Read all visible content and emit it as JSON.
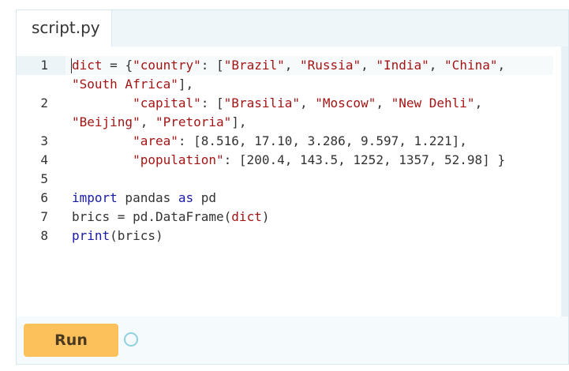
{
  "tab": {
    "label": "script.py"
  },
  "run_button": {
    "label": "Run"
  },
  "editor": {
    "line_numbers": [
      "1",
      "2",
      "3",
      "4",
      "5",
      "6",
      "7",
      "8"
    ],
    "lines": [
      {
        "tokens": [
          {
            "t": "dict",
            "c": "str"
          },
          {
            "t": " = ",
            "c": "op"
          },
          {
            "t": "{",
            "c": "op"
          },
          {
            "t": "\"country\"",
            "c": "str"
          },
          {
            "t": ": [",
            "c": "op"
          },
          {
            "t": "\"Brazil\"",
            "c": "str"
          },
          {
            "t": ", ",
            "c": "op"
          },
          {
            "t": "\"Russia\"",
            "c": "str"
          },
          {
            "t": ", ",
            "c": "op"
          },
          {
            "t": "\"India\"",
            "c": "str"
          },
          {
            "t": ", ",
            "c": "op"
          },
          {
            "t": "\"China\"",
            "c": "str"
          },
          {
            "t": ",",
            "c": "op"
          }
        ]
      },
      {
        "tokens": [
          {
            "t": "\"South Africa\"",
            "c": "str"
          },
          {
            "t": "],",
            "c": "op"
          }
        ]
      },
      {
        "tokens": [
          {
            "t": "        ",
            "c": "op"
          },
          {
            "t": "\"capital\"",
            "c": "str"
          },
          {
            "t": ": [",
            "c": "op"
          },
          {
            "t": "\"Brasilia\"",
            "c": "str"
          },
          {
            "t": ", ",
            "c": "op"
          },
          {
            "t": "\"Moscow\"",
            "c": "str"
          },
          {
            "t": ", ",
            "c": "op"
          },
          {
            "t": "\"New Dehli\"",
            "c": "str"
          },
          {
            "t": ",",
            "c": "op"
          }
        ]
      },
      {
        "tokens": [
          {
            "t": "\"Beijing\"",
            "c": "str"
          },
          {
            "t": ", ",
            "c": "op"
          },
          {
            "t": "\"Pretoria\"",
            "c": "str"
          },
          {
            "t": "],",
            "c": "op"
          }
        ]
      },
      {
        "tokens": [
          {
            "t": "        ",
            "c": "op"
          },
          {
            "t": "\"area\"",
            "c": "str"
          },
          {
            "t": ": [8.516, 17.10, 3.286, 9.597, 1.221],",
            "c": "op"
          }
        ]
      },
      {
        "tokens": [
          {
            "t": "        ",
            "c": "op"
          },
          {
            "t": "\"population\"",
            "c": "str"
          },
          {
            "t": ": [200.4, 143.5, 1252, 1357, 52.98] }",
            "c": "op"
          }
        ]
      },
      {
        "tokens": []
      },
      {
        "tokens": [
          {
            "t": "import",
            "c": "kw"
          },
          {
            "t": " pandas ",
            "c": "op"
          },
          {
            "t": "as",
            "c": "kw"
          },
          {
            "t": " pd",
            "c": "op"
          }
        ]
      },
      {
        "tokens": [
          {
            "t": "brics = pd.DataFrame(",
            "c": "op"
          },
          {
            "t": "dict",
            "c": "str"
          },
          {
            "t": ")",
            "c": "op"
          }
        ]
      },
      {
        "tokens": [
          {
            "t": "print",
            "c": "kw"
          },
          {
            "t": "(brics)",
            "c": "op"
          }
        ]
      }
    ]
  },
  "colors": {
    "run_button": "#fcc15a",
    "keyword": "#1a1aa6",
    "string": "#a31515",
    "panel": "#eef6f9"
  },
  "icons": {
    "spinner": "loading-circle-icon"
  }
}
